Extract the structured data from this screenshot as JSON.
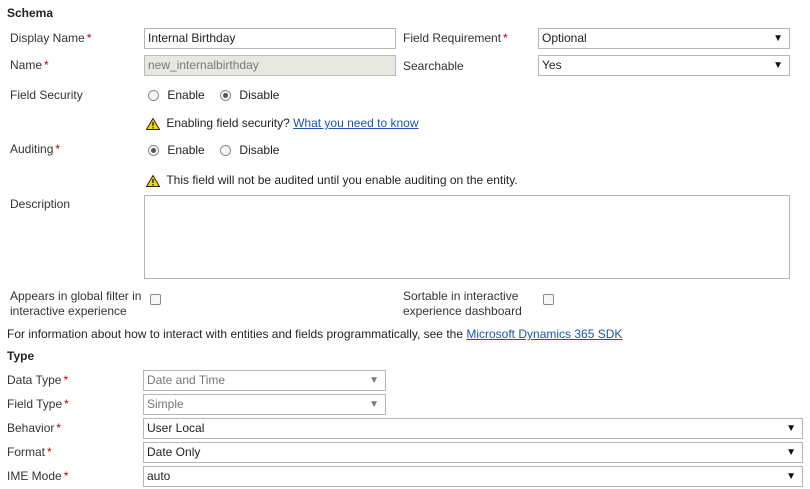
{
  "schema": {
    "title": "Schema",
    "display_name": {
      "label": "Display Name",
      "value": "Internal Birthday"
    },
    "name": {
      "label": "Name",
      "value": "new_internalbirthday"
    },
    "field_requirement": {
      "label": "Field Requirement",
      "value": "Optional"
    },
    "searchable": {
      "label": "Searchable",
      "value": "Yes"
    },
    "field_security": {
      "label": "Field Security",
      "enable": "Enable",
      "disable": "Disable",
      "selected": "Disable"
    },
    "field_security_warning": {
      "text": "Enabling field security?",
      "link": "What you need to know"
    },
    "auditing": {
      "label": "Auditing",
      "enable": "Enable",
      "disable": "Disable",
      "selected": "Enable"
    },
    "auditing_warning": "This field will not be audited until you enable auditing on the entity.",
    "description": {
      "label": "Description",
      "value": ""
    },
    "global_filter": {
      "label_line1": "Appears in global filter in",
      "label_line2": "interactive experience"
    },
    "sortable": {
      "label_line1": "Sortable in interactive",
      "label_line2": "experience dashboard"
    },
    "sdk_note": {
      "text": "For information about how to interact with entities and fields programmatically, see the",
      "link": "Microsoft Dynamics 365 SDK"
    }
  },
  "type": {
    "title": "Type",
    "data_type": {
      "label": "Data Type",
      "value": "Date and Time"
    },
    "field_type": {
      "label": "Field Type",
      "value": "Simple"
    },
    "behavior": {
      "label": "Behavior",
      "value": "User Local"
    },
    "format": {
      "label": "Format",
      "value": "Date Only"
    },
    "ime_mode": {
      "label": "IME Mode",
      "value": "auto"
    }
  },
  "icons": {
    "required": "*",
    "dropdown": "▼",
    "warning": "warning-icon"
  },
  "colors": {
    "required": "#c00000",
    "link": "#1a56b0",
    "readonly_bg": "#e8e8e3"
  }
}
